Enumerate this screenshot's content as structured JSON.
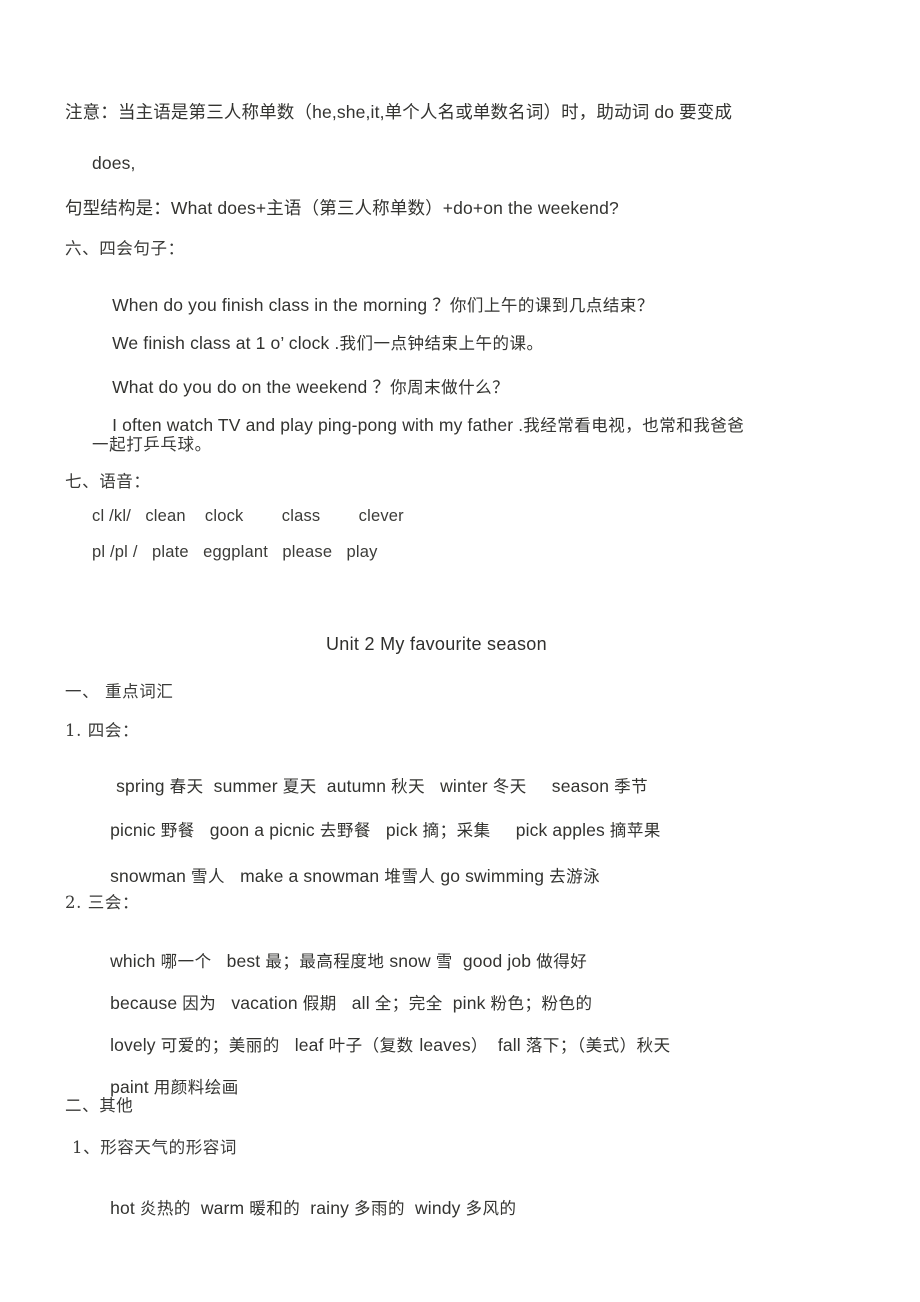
{
  "document": {
    "note_line_1": "注意：当主语是第三人称单数（he,she,it,单个人名或单数名词）时，助动词 do 要变成",
    "note_line_2": "does,",
    "structure_line": "句型结构是：What does+主语（第三人称单数）+do+on the weekend?",
    "section_six_heading": "六、四会句子：",
    "sentences": [
      {
        "en": "When do you finish class in the morning ？",
        "zh": "你们上午的课到几点结束？"
      },
      {
        "en": "We finish class at 1 o’ clock .",
        "zh": "我们一点钟结束上午的课。"
      },
      {
        "en": "What do you do on the weekend ？",
        "zh": "你周末做什么？"
      },
      {
        "en": "I often watch TV and play ping-pong with my father .",
        "zh": "我经常看电视，也常和我爸爸"
      }
    ],
    "sentence_wrap": "一起打乒乓球。",
    "section_seven_heading": "七、语音：",
    "phonics": [
      "cl /kl/   clean    clock        class        clever",
      "pl /pl /   plate   eggplant   please   play"
    ],
    "unit_title": "Unit 2 My favourite season",
    "section_one_heading": "一、 重点词汇",
    "sub_heading_1": "1. 四会：",
    "four_skills_rows": [
      [
        {
          "en": "spring ",
          "zh": "春天"
        },
        {
          "en": "  summer ",
          "zh": "夏天"
        },
        {
          "en": "  autumn ",
          "zh": "秋天"
        },
        {
          "en": "   winter ",
          "zh": "冬天"
        },
        {
          "en": "     season ",
          "zh": "季节"
        }
      ],
      [
        {
          "en": "picnic ",
          "zh": "野餐"
        },
        {
          "en": "   goon a picnic ",
          "zh": "去野餐"
        },
        {
          "en": "   pick ",
          "zh": "摘；采集"
        },
        {
          "en": "     pick apples ",
          "zh": "摘苹果"
        }
      ],
      [
        {
          "en": "snowman ",
          "zh": "雪人"
        },
        {
          "en": "   make a snowman ",
          "zh": "堆雪人"
        },
        {
          "en": " go swimming ",
          "zh": "去游泳"
        }
      ]
    ],
    "sub_heading_2": "2. 三会：",
    "three_skills_rows": [
      [
        {
          "en": "which ",
          "zh": "哪一个"
        },
        {
          "en": "   best ",
          "zh": "最；最高程度地"
        },
        {
          "en": " snow ",
          "zh": "雪"
        },
        {
          "en": "  good job ",
          "zh": "做得好"
        }
      ],
      [
        {
          "en": "because ",
          "zh": "因为"
        },
        {
          "en": "   vacation ",
          "zh": "假期"
        },
        {
          "en": "   all ",
          "zh": "全；完全"
        },
        {
          "en": "  pink ",
          "zh": "粉色；粉色的"
        }
      ],
      [
        {
          "en": "lovely ",
          "zh": "可爱的；美丽的"
        },
        {
          "en": "   leaf ",
          "zh": "叶子（复数 "
        },
        {
          "en": "leaves",
          "zh": "）"
        },
        {
          "en": "  fall ",
          "zh": "落下；（美式）秋天"
        }
      ],
      [
        {
          "en": "paint ",
          "zh": "用颜料绘画"
        }
      ]
    ],
    "section_two_heading": "二、其他",
    "sub_heading_weather": "1、形容天气的形容词",
    "weather_row": [
      {
        "en": "hot ",
        "zh": "炎热的"
      },
      {
        "en": "  warm ",
        "zh": "暖和的"
      },
      {
        "en": "  rainy ",
        "zh": "多雨的"
      },
      {
        "en": "  windy ",
        "zh": "多风的"
      }
    ]
  }
}
